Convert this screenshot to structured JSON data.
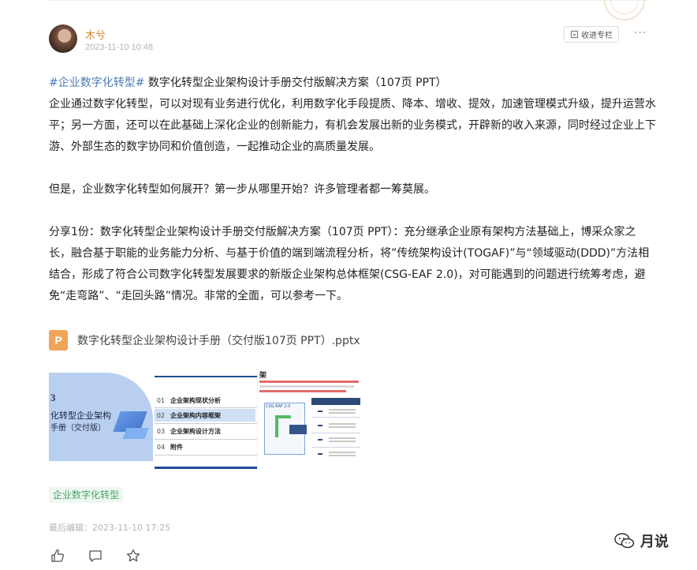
{
  "post": {
    "author": "木兮",
    "timestamp": "2023-11-10 10:48",
    "collect_label": "收进专栏",
    "more_label": "···",
    "hashtag": "#企业数字化转型#",
    "title_text": " 数字化转型企业架构设计手册交付版解决方案（107页 PPT）",
    "paragraphs": [
      "企业通过数字化转型，可以对现有业务进行优化，利用数字化手段提质、降本、增收、提效，加速管理模式升级，提升运营水平；另一方面，还可以在此基础上深化企业的创新能力，有机会发展出新的业务模式，开辟新的收入来源，同时经过企业上下游、外部生态的数字协同和价值创造，一起推动企业的高质量发展。",
      "但是，企业数字化转型如何展开？第一步从哪里开始？许多管理者都一筹莫展。",
      "分享1份：数字化转型企业架构设计手册交付版解决方案（107页 PPT）：充分继承企业原有架构方法基础上，博采众家之长，融合基于职能的业务能力分析、与基于价值的端到端流程分析，将”传统架构设计(TOGAF)”与“领域驱动(DDD)”方法相结合，形成了符合公司数字化转型发展要求的新版企业架构总体框架(CSG-EAF 2.0)，对可能遇到的问题进行统筹考虑，避免“走弯路”、“走回头路”情况。非常的全面，可以参考一下。"
    ],
    "attachment": {
      "icon_letter": "P",
      "file_name": "数字化转型企业架构设计手册（交付版107页 PPT）.pptx"
    },
    "thumbnails": {
      "cover": {
        "number": "3",
        "title_line1": "化转型企业架构",
        "title_line2": "手册（交付版）"
      },
      "toc": [
        {
          "num": "01",
          "label": "企业架构现状分析"
        },
        {
          "num": "02",
          "label": "企业架构内容框架"
        },
        {
          "num": "03",
          "label": "企业架构设计方法"
        },
        {
          "num": "04",
          "label": "附件"
        }
      ],
      "detail": {
        "title": "架",
        "diagram_label": "CSG-EAF 2.0"
      }
    },
    "topic_tag": "企业数字化转型",
    "last_edit": "最后编辑：2023-11-10 17:25",
    "watermark_text": "月说"
  },
  "colors": {
    "author": "#d88a32",
    "hashtag": "#4e7ab5",
    "tag_bg": "#eef8f1",
    "tag_text": "#4aa368",
    "file_icon": "#f0a45a"
  },
  "icons": [
    "bookmark-icon",
    "more-icon",
    "ppt-file-icon",
    "like-icon",
    "comment-icon",
    "star-icon",
    "wechat-icon"
  ]
}
